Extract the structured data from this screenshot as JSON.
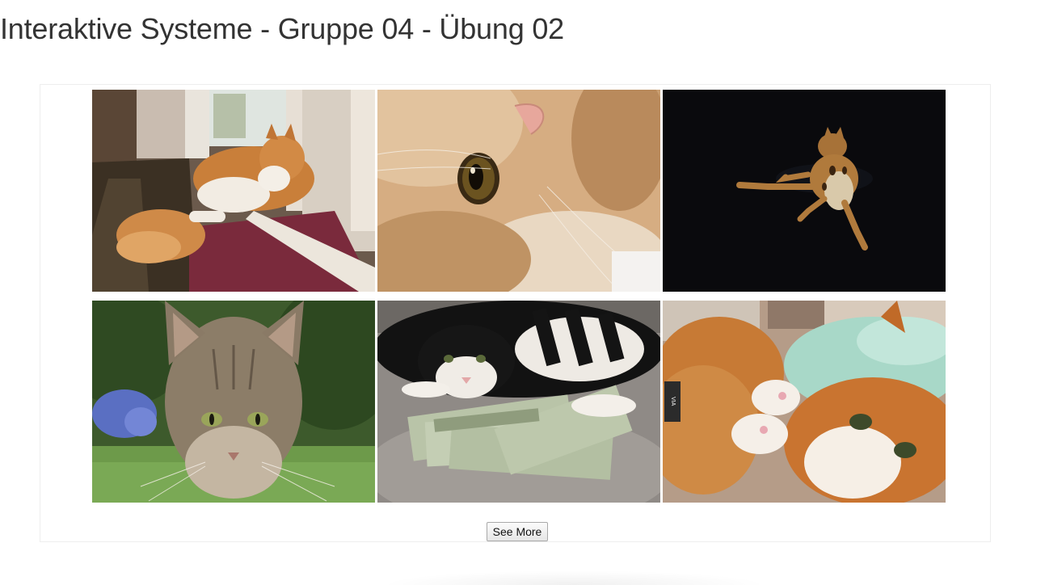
{
  "header": {
    "title": "Interaktive Systeme - Gruppe 04 - Übung 02"
  },
  "gallery": {
    "images": [
      {
        "name": "cat-image-1",
        "subject": "fluffy orange and white cat lying by a door",
        "watermark": ""
      },
      {
        "name": "cat-image-2",
        "subject": "close-up of orange cat eye",
        "watermark": ""
      },
      {
        "name": "cat-image-3",
        "subject": "bengal cat leaping on black background",
        "watermark": ""
      },
      {
        "name": "cat-image-4",
        "subject": "grumpy tabby cat in garden",
        "watermark": ""
      },
      {
        "name": "cat-image-5",
        "subject": "black and white cat lying on dollar bills",
        "watermark": ""
      },
      {
        "name": "cat-image-6",
        "subject": "orange and white cat lying on back",
        "watermark": "VIA 9GAG.COM"
      }
    ],
    "see_more_label": "See More"
  },
  "colors": {
    "title": "#333333",
    "gallery_border": "#eeeeee",
    "button_border": "#a9a9a9"
  }
}
